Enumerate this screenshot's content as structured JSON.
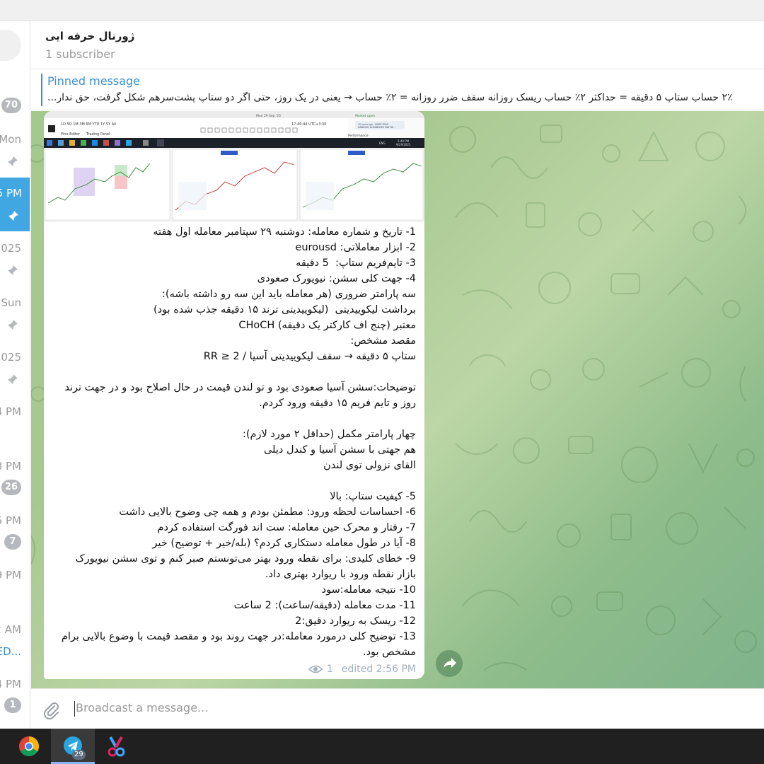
{
  "chat_list": {
    "times": [
      "Mon",
      "5 PM",
      "2025",
      "Sun",
      "2025",
      "4 PM",
      "3 PM",
      "5 PM",
      "9 PM",
      "2 AM",
      "4 PM"
    ],
    "badges": [
      "70",
      "26",
      "7",
      "1"
    ],
    "link_text": "ED..."
  },
  "header": {
    "title": "ژورنال حرفه ایی",
    "subtitle": "1 subscriber"
  },
  "pinned": {
    "label": "Pinned message",
    "text": "۲٪ حساب  ستاپ ۵ دقیقه = حداکثر ۲٪ حساب  ریسک روزانه  سقف ضرر روزانه = ۲٪ حساب → یعنی در یک روز، حتی اگر دو ستاپ پشت‌سرهم شکل گرفت، حق ندار..."
  },
  "message": {
    "lines": [
      "1- تاریخ و شماره معامله: دوشنبه ۲۹ سپتامبر معامله اول هفته",
      "2- ابزار معاملاتی: eurousd",
      "3- تایم‌فریم ستاپ:  5 دقیقه",
      "4- جهت کلی سشن: نیویورک صعودی",
      "سه پارامتر ضروری (هر معامله باید این سه رو داشته باشه):",
      "برداشت لیکوییدیتی  (لیکوییدیتی ترند ۱۵ دقیقه جذب شده بود)",
      "CHoCH معتبر (چنج اف کارکتر یک دقیقه)",
      "مقصد مشخص:",
      "ستاپ ۵ دقیقه → سقف لیکوییدیتی آسیا / RR ≥ 2",
      "",
      "توضیحات:سشن آسیا صعودی بود و تو لندن قیمت در حال اصلاح بود و در جهت ترند روز و تایم فریم ۱۵ دقیقه ورود کردم.",
      "",
      "چهار پارامتر مکمل (حداقل ۲ مورد لازم):",
      "هم جهتی با سشن آسیا و کندل دیلی",
      "القای نزولی توی لندن",
      "",
      "5- کیفیت ستاپ: بالا",
      "6- احساسات لحظه ورود: مطمئن بودم و همه چی وضوح بالایی داشت",
      "7- رفتار و محرک حین معامله: ست اند فورگت استفاده کردم",
      "8- آیا در طول معامله دستکاری کردم؟ (بله/خیر + توضیح) خیر",
      "9- خطای کلیدی: برای نقطه ورود بهتر می‌تونستم صبر کنم و توی سشن نیویورک بازار نقطه ورود با ریوارد بهتری داد.",
      "10- نتیجه معامله:سود",
      "11- مدت معامله (دقیقه/ساعت): 2 ساعت",
      "12- ریسک به ریوارد دقیق:2",
      "13- توضیح کلی درمورد معامله:در جهت روند بود و مقصد قیمت با وضوع بالایی برام مشخص بود."
    ],
    "views": "1",
    "edited": "edited 2:56 PM"
  },
  "screenshot": {
    "timeframes": [
      "1D",
      "5D",
      "1M",
      "3M",
      "6M",
      "YTD",
      "1Y",
      "5Y",
      "All"
    ],
    "clock": "17:40:44 UTC+3:30",
    "tabs": [
      "Pine Editor",
      "Trading Panel"
    ],
    "chart_date": "Mon 29 Sep '25",
    "market_open": "Market open",
    "notif": "12 hours ago · MORE FEDS HAWKISH; BUSINESSES MAY BE...",
    "perf": "Performance",
    "sys_time": "5:40 PM",
    "sys_date": "9/29/2025",
    "lang": "ENG"
  },
  "input": {
    "placeholder": "Broadcast a message..."
  },
  "taskbar": {
    "telegram_badge": "29"
  },
  "colors": {
    "accent": "#3a8fd0",
    "active_chat": "#40a7e3",
    "badge": "#b5b9bd",
    "taskbar": "#202020"
  }
}
